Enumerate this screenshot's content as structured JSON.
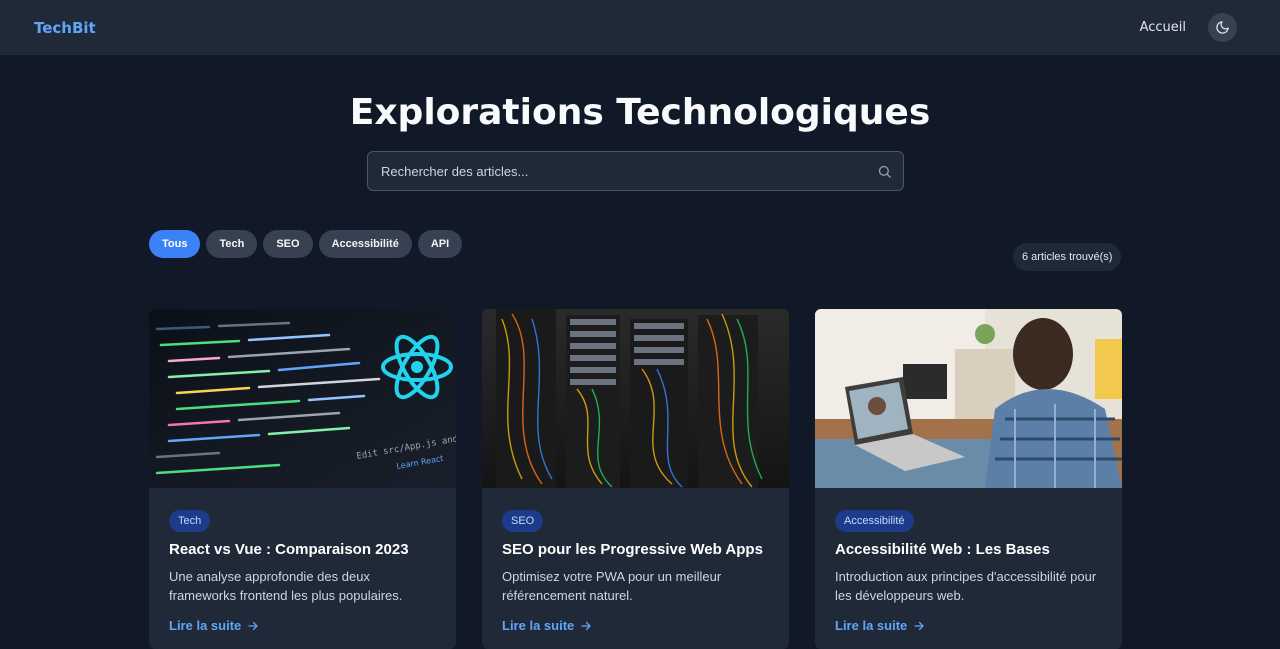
{
  "navbar": {
    "brand": "TechBit",
    "home_link": "Accueil",
    "theme_icon": "moon-icon"
  },
  "hero": {
    "title": "Explorations Technologiques"
  },
  "search": {
    "placeholder": "Rechercher des articles...",
    "value": "",
    "icon": "search-icon"
  },
  "filters": {
    "items": [
      "Tous",
      "Tech",
      "SEO",
      "Accessibilité",
      "API"
    ],
    "active": "Tous"
  },
  "results": {
    "count_label": "6 articles trouvé(s)"
  },
  "colors": {
    "accent": "#3b82f6",
    "link": "#60a5fa",
    "background": "#111827",
    "card": "#1f2937"
  },
  "articles": [
    {
      "category": "Tech",
      "title": "React vs Vue : Comparaison 2023",
      "description": "Une analyse approfondie des deux frameworks frontend les plus populaires.",
      "link_label": "Lire la suite",
      "image_text": "Edit src/App.js and save to reload.",
      "image_link": "Learn React"
    },
    {
      "category": "SEO",
      "title": "SEO pour les Progressive Web Apps",
      "description": "Optimisez votre PWA pour un meilleur référencement naturel.",
      "link_label": "Lire la suite"
    },
    {
      "category": "Accessibilité",
      "title": "Accessibilité Web : Les Bases",
      "description": "Introduction aux principes d'accessibilité pour les développeurs web.",
      "link_label": "Lire la suite"
    }
  ]
}
